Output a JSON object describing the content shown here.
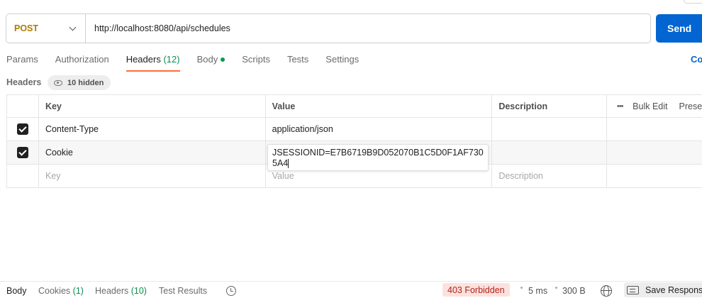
{
  "request": {
    "method": "POST",
    "url": "http://localhost:8080/api/schedules",
    "send_label": "Send"
  },
  "tabs": [
    {
      "label": "Params"
    },
    {
      "label": "Authorization"
    },
    {
      "label": "Headers",
      "count": "(12)",
      "active": true
    },
    {
      "label": "Body",
      "dot": true
    },
    {
      "label": "Scripts"
    },
    {
      "label": "Tests"
    },
    {
      "label": "Settings"
    }
  ],
  "cookies_link": "Co",
  "headers_section": {
    "title": "Headers",
    "hidden_label": "10 hidden"
  },
  "table": {
    "columns": [
      "Key",
      "Value",
      "Description"
    ],
    "bulk_edit": "Bulk Edit",
    "presets": "Prese",
    "rows": [
      {
        "checked": true,
        "key": "Content-Type",
        "value": "application/json",
        "description": ""
      },
      {
        "checked": true,
        "key": "Cookie",
        "value": "JSESSIONID=E7B6719B9D052070B1C5D0F1AF7305A4",
        "description": ""
      }
    ],
    "placeholders": {
      "key": "Key",
      "value": "Value",
      "description": "Description"
    }
  },
  "footer": {
    "tabs": [
      {
        "label": "Body",
        "active": true
      },
      {
        "label": "Cookies",
        "count": "(1)"
      },
      {
        "label": "Headers",
        "count": "(10)"
      },
      {
        "label": "Test Results"
      }
    ],
    "status": "403 Forbidden",
    "time": "5 ms",
    "size": "300 B",
    "save_response": "Save Response"
  },
  "colors": {
    "send_button": "#0265d2",
    "method": "#ad7a03",
    "active_tab_underline": "#ff6c37",
    "status_bg": "#fbe2df",
    "status_text": "#b42318"
  },
  "icons": [
    "chevron-down-icon",
    "eye-icon",
    "checkbox-icon",
    "more-dots-icon",
    "history-icon",
    "globe-icon",
    "save-response-icon"
  ]
}
